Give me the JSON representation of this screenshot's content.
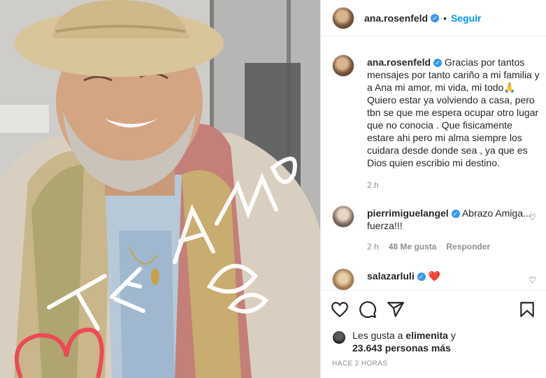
{
  "header": {
    "username": "ana.rosenfeld",
    "separator": "•",
    "follow_label": "Seguir"
  },
  "caption": {
    "username": "ana.rosenfeld",
    "text": "Gracias por tantos mensajes por tanto cariño a mi familia y a Ana mi amor, mi vida, mi todo🙏 Quiero estar ya volviendo a casa, pero tbn se que me espera ocupar otro lugar que no conocia . Que fisicamente estare ahi pero mi alma siempre los cuidara desde donde sea , ya que es Dios quien escribio mi destino.",
    "time": "2 h"
  },
  "comments": [
    {
      "username": "pierrimiguelangel",
      "text": "Abrazo Amiga... fuerza!!!",
      "time": "2 h",
      "likes": "48 Me gusta",
      "reply_label": "Responder"
    },
    {
      "username": "salazarluli",
      "text": "❤️"
    }
  ],
  "likes": {
    "prefix": "Les gusta a",
    "user": "elimenita",
    "connector": "y",
    "others": "23.643 personas más"
  },
  "timestamp": "HACE 2 HORAS",
  "photo_overlay_text": "TE AMO BEBA",
  "colors": {
    "accent": "#0095f6",
    "verified": "#3897f0",
    "text": "#262626",
    "muted": "#8e8e8e",
    "border": "#efefef",
    "heart_red": "#ed4956"
  },
  "icons": [
    "verified-badge-icon",
    "like-icon",
    "comment-icon",
    "share-icon",
    "save-icon",
    "heart-outline-icon"
  ]
}
